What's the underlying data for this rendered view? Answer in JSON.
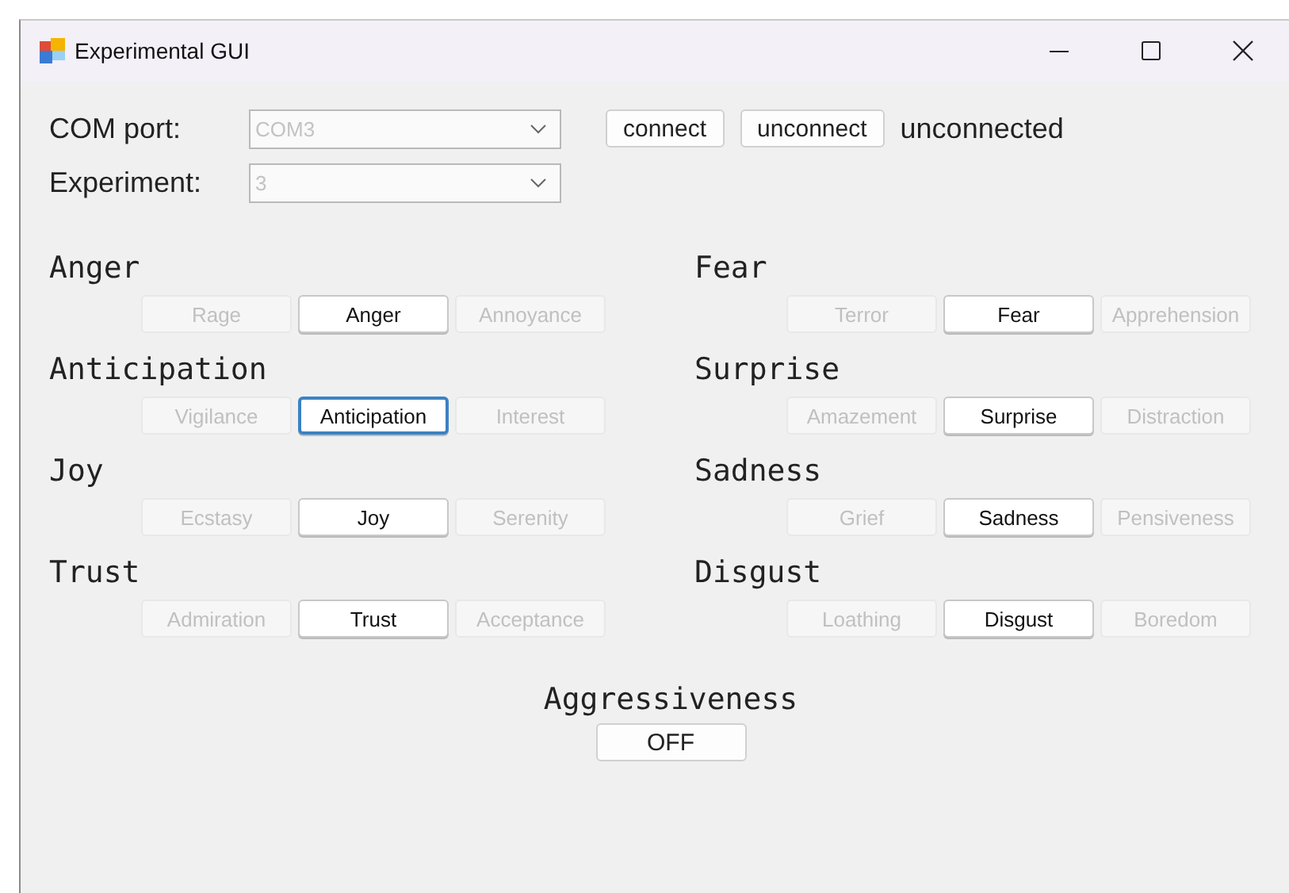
{
  "window": {
    "title": "Experimental GUI"
  },
  "connection": {
    "fields": [
      {
        "label": "COM port:",
        "value": "COM3",
        "disabled": true
      },
      {
        "label": "Experiment:",
        "value": "3",
        "disabled": true
      }
    ],
    "buttons": [
      {
        "label": "connect"
      },
      {
        "label": "unconnect"
      }
    ],
    "status": "unconnected"
  },
  "emotions": [
    {
      "name": "Anger",
      "options": [
        {
          "label": "Rage",
          "disabled": true,
          "focused": false
        },
        {
          "label": "Anger",
          "disabled": false,
          "focused": false
        },
        {
          "label": "Annoyance",
          "disabled": true,
          "focused": false
        }
      ]
    },
    {
      "name": "Fear",
      "options": [
        {
          "label": "Terror",
          "disabled": true,
          "focused": false
        },
        {
          "label": "Fear",
          "disabled": false,
          "focused": false
        },
        {
          "label": "Apprehension",
          "disabled": true,
          "focused": false
        }
      ]
    },
    {
      "name": "Anticipation",
      "options": [
        {
          "label": "Vigilance",
          "disabled": true,
          "focused": false
        },
        {
          "label": "Anticipation",
          "disabled": false,
          "focused": true
        },
        {
          "label": "Interest",
          "disabled": true,
          "focused": false
        }
      ]
    },
    {
      "name": "Surprise",
      "options": [
        {
          "label": "Amazement",
          "disabled": true,
          "focused": false
        },
        {
          "label": "Surprise",
          "disabled": false,
          "focused": false
        },
        {
          "label": "Distraction",
          "disabled": true,
          "focused": false
        }
      ]
    },
    {
      "name": "Joy",
      "options": [
        {
          "label": "Ecstasy",
          "disabled": true,
          "focused": false
        },
        {
          "label": "Joy",
          "disabled": false,
          "focused": false
        },
        {
          "label": "Serenity",
          "disabled": true,
          "focused": false
        }
      ]
    },
    {
      "name": "Sadness",
      "options": [
        {
          "label": "Grief",
          "disabled": true,
          "focused": false
        },
        {
          "label": "Sadness",
          "disabled": false,
          "focused": false
        },
        {
          "label": "Pensiveness",
          "disabled": true,
          "focused": false
        }
      ]
    },
    {
      "name": "Trust",
      "options": [
        {
          "label": "Admiration",
          "disabled": true,
          "focused": false
        },
        {
          "label": "Trust",
          "disabled": false,
          "focused": false
        },
        {
          "label": "Acceptance",
          "disabled": true,
          "focused": false
        }
      ]
    },
    {
      "name": "Disgust",
      "options": [
        {
          "label": "Loathing",
          "disabled": true,
          "focused": false
        },
        {
          "label": "Disgust",
          "disabled": false,
          "focused": false
        },
        {
          "label": "Boredom",
          "disabled": true,
          "focused": false
        }
      ]
    }
  ],
  "aggressiveness": {
    "label": "Aggressiveness",
    "button": "OFF"
  }
}
